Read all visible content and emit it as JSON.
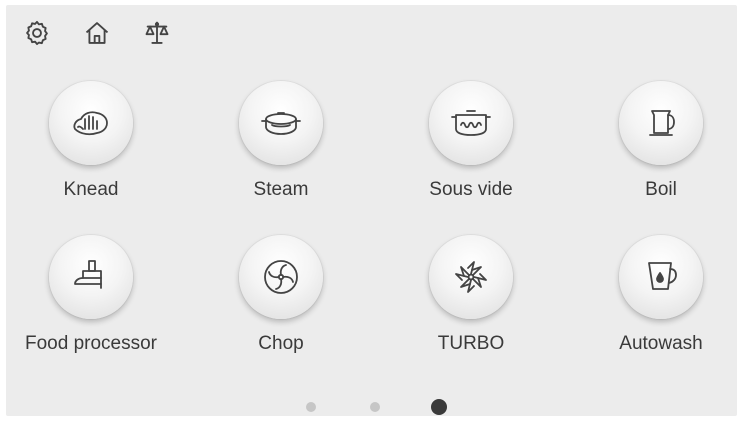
{
  "topbar": {
    "icons": [
      "gear-icon",
      "home-icon",
      "scale-icon"
    ]
  },
  "modes": [
    {
      "label": "Knead",
      "icon": "knead-hand-icon"
    },
    {
      "label": "Steam",
      "icon": "steam-pot-icon"
    },
    {
      "label": "Sous vide",
      "icon": "sous-vide-pot-icon"
    },
    {
      "label": "Boil",
      "icon": "kettle-icon"
    },
    {
      "label": "Food processor",
      "icon": "food-processor-icon"
    },
    {
      "label": "Chop",
      "icon": "chop-blade-icon"
    },
    {
      "label": "TURBO",
      "icon": "turbo-blade-icon"
    },
    {
      "label": "Autowash",
      "icon": "autowash-jug-icon"
    }
  ],
  "pagination": {
    "pages": 3,
    "current": 3
  },
  "colors": {
    "background": "#ececec",
    "icon_stroke": "#444444",
    "dot_active": "#3a3a3a",
    "dot_inactive": "#c6c6c6"
  }
}
